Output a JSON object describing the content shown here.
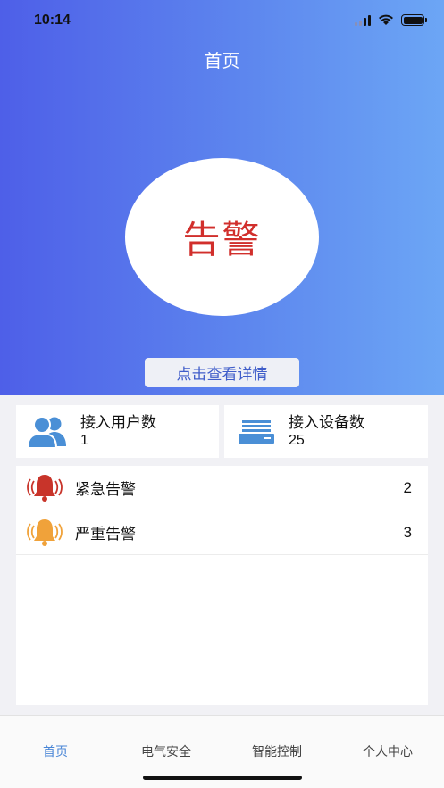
{
  "status": {
    "time": "10:14"
  },
  "header": {
    "title": "首页"
  },
  "hero": {
    "alarm_text": "告警",
    "alarm_color": "#d12f2c",
    "detail_button": "点击查看详情"
  },
  "stats": {
    "users": {
      "label": "接入用户数",
      "value": "1",
      "icon": "users-icon"
    },
    "devices": {
      "label": "接入设备数",
      "value": "25",
      "icon": "server-icon"
    }
  },
  "alarms": [
    {
      "label": "紧急告警",
      "count": "2",
      "icon": "bell-red-icon",
      "color": "#c8342a"
    },
    {
      "label": "严重告警",
      "count": "3",
      "icon": "bell-orange-icon",
      "color": "#f0a23a"
    }
  ],
  "tabbar": {
    "items": [
      {
        "label": "首页",
        "active": true
      },
      {
        "label": "电气安全",
        "active": false
      },
      {
        "label": "智能控制",
        "active": false
      },
      {
        "label": "个人中心",
        "active": false
      }
    ]
  },
  "colors": {
    "gradient_start": "#4e5fe8",
    "gradient_end": "#6ca6f5",
    "tab_active": "#4a86d6"
  }
}
